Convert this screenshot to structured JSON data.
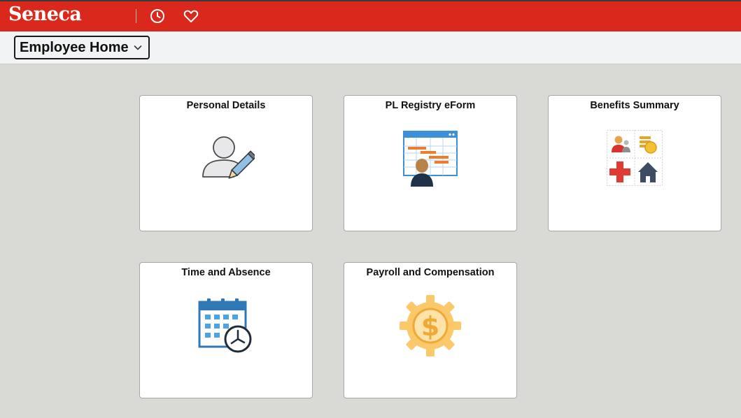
{
  "header": {
    "logo_text": "Seneca",
    "recent_icon": "clock-icon",
    "favorites_icon": "heart-icon",
    "brand_color": "#da291c"
  },
  "subheader": {
    "homepage_label": "Employee Home",
    "dropdown_icon": "chevron-down-icon"
  },
  "tiles": [
    {
      "title": "Personal Details",
      "icon": "person-edit-icon"
    },
    {
      "title": "PL Registry eForm",
      "icon": "registry-form-icon"
    },
    {
      "title": "Benefits Summary",
      "icon": "benefits-grid-icon"
    },
    {
      "title": "Time and Absence",
      "icon": "calendar-clock-icon"
    },
    {
      "title": "Payroll and Compensation",
      "icon": "dollar-gear-icon"
    }
  ]
}
